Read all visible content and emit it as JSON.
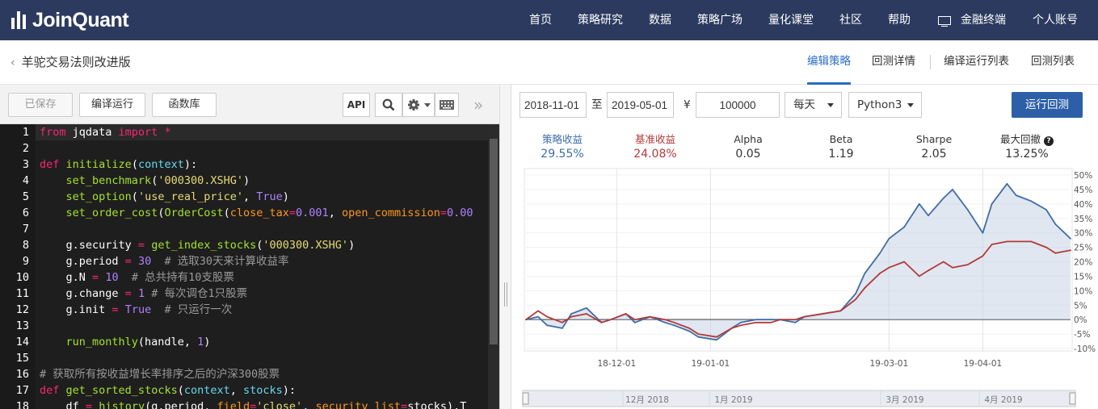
{
  "brand": {
    "name": "JoinQuant"
  },
  "nav": {
    "items": [
      "首页",
      "策略研究",
      "数据",
      "策略广场",
      "量化课堂",
      "社区",
      "帮助"
    ],
    "terminal": "金融终端",
    "account": "个人账号"
  },
  "page": {
    "title": "羊驼交易法则改进版"
  },
  "subtabs": [
    "编辑策略",
    "回测详情",
    "编译运行列表",
    "回测列表"
  ],
  "editor": {
    "saved_label": "已保存",
    "compile_label": "编译运行",
    "library_label": "函数库",
    "api_label": "API",
    "lines": [
      {
        "n": "1",
        "segs": [
          [
            "kw",
            "from"
          ],
          [
            "",
            " jqdata "
          ],
          [
            "kw",
            "import"
          ],
          [
            "",
            " "
          ],
          [
            "kw",
            "*"
          ]
        ]
      },
      {
        "n": "2",
        "segs": []
      },
      {
        "n": "3",
        "segs": [
          [
            "kw",
            "def"
          ],
          [
            "",
            " "
          ],
          [
            "fn",
            "initialize"
          ],
          [
            "",
            "("
          ],
          [
            "bl",
            "context"
          ],
          [
            "",
            "):"
          ]
        ]
      },
      {
        "n": "4",
        "segs": [
          [
            "",
            "    "
          ],
          [
            "fn",
            "set_benchmark"
          ],
          [
            "",
            "("
          ],
          [
            "st",
            "'000300.XSHG'"
          ],
          [
            "",
            ")"
          ]
        ]
      },
      {
        "n": "5",
        "segs": [
          [
            "",
            "    "
          ],
          [
            "fn",
            "set_option"
          ],
          [
            "",
            "("
          ],
          [
            "st",
            "'use_real_price'"
          ],
          [
            "",
            ", "
          ],
          [
            "nm",
            "True"
          ],
          [
            "",
            ")"
          ]
        ]
      },
      {
        "n": "6",
        "segs": [
          [
            "",
            "    "
          ],
          [
            "fn",
            "set_order_cost"
          ],
          [
            "",
            "("
          ],
          [
            "fn",
            "OrderCost"
          ],
          [
            "",
            "("
          ],
          [
            "pm",
            "close_tax"
          ],
          [
            "kw",
            "="
          ],
          [
            "nm",
            "0.001"
          ],
          [
            "",
            ", "
          ],
          [
            "pm",
            "open_commission"
          ],
          [
            "kw",
            "="
          ],
          [
            "nm",
            "0.00"
          ]
        ]
      },
      {
        "n": "7",
        "segs": []
      },
      {
        "n": "8",
        "segs": [
          [
            "",
            "    g.security "
          ],
          [
            "kw",
            "="
          ],
          [
            "",
            " "
          ],
          [
            "fn",
            "get_index_stocks"
          ],
          [
            "",
            "("
          ],
          [
            "st",
            "'000300.XSHG'"
          ],
          [
            "",
            ")"
          ]
        ]
      },
      {
        "n": "9",
        "segs": [
          [
            "",
            "    g.period "
          ],
          [
            "kw",
            "="
          ],
          [
            "",
            " "
          ],
          [
            "nm",
            "30"
          ],
          [
            "",
            "  "
          ],
          [
            "cm",
            "# 选取30天来计算收益率"
          ]
        ]
      },
      {
        "n": "10",
        "segs": [
          [
            "",
            "    g.N "
          ],
          [
            "kw",
            "="
          ],
          [
            "",
            " "
          ],
          [
            "nm",
            "10"
          ],
          [
            "",
            "  "
          ],
          [
            "cm",
            "# 总共持有10支股票"
          ]
        ]
      },
      {
        "n": "11",
        "segs": [
          [
            "",
            "    g.change "
          ],
          [
            "kw",
            "="
          ],
          [
            "",
            " "
          ],
          [
            "nm",
            "1"
          ],
          [
            "",
            " "
          ],
          [
            "cm",
            "# 每次调仓1只股票"
          ]
        ]
      },
      {
        "n": "12",
        "segs": [
          [
            "",
            "    g.init "
          ],
          [
            "kw",
            "="
          ],
          [
            "",
            " "
          ],
          [
            "nm",
            "True"
          ],
          [
            "",
            "  "
          ],
          [
            "cm",
            "# 只运行一次"
          ]
        ]
      },
      {
        "n": "13",
        "segs": []
      },
      {
        "n": "14",
        "segs": [
          [
            "",
            "    "
          ],
          [
            "fn",
            "run_monthly"
          ],
          [
            "",
            "(handle, "
          ],
          [
            "nm",
            "1"
          ],
          [
            "",
            ")"
          ]
        ]
      },
      {
        "n": "15",
        "segs": []
      },
      {
        "n": "16",
        "segs": [
          [
            "cm",
            "# 获取所有按收益增长率排序之后的沪深300股票"
          ]
        ]
      },
      {
        "n": "17",
        "segs": [
          [
            "kw",
            "def"
          ],
          [
            "",
            " "
          ],
          [
            "fn",
            "get_sorted_stocks"
          ],
          [
            "",
            "("
          ],
          [
            "bl",
            "context"
          ],
          [
            "",
            ", "
          ],
          [
            "bl",
            "stocks"
          ],
          [
            "",
            "):"
          ]
        ]
      },
      {
        "n": "18",
        "segs": [
          [
            "",
            "    df "
          ],
          [
            "kw",
            "="
          ],
          [
            "",
            " "
          ],
          [
            "fn",
            "history"
          ],
          [
            "",
            "(g.period, "
          ],
          [
            "pm",
            "field"
          ],
          [
            "kw",
            "="
          ],
          [
            "st",
            "'close'"
          ],
          [
            "",
            ", "
          ],
          [
            "pm",
            "security_list"
          ],
          [
            "kw",
            "="
          ],
          [
            "",
            "stocks).T"
          ]
        ]
      }
    ]
  },
  "backtest": {
    "start": "2018-11-01",
    "to": "至",
    "end": "2019-05-01",
    "currency": "¥",
    "capital": "100000",
    "freq": "每天",
    "lang": "Python3",
    "run_label": "运行回测"
  },
  "metrics": [
    {
      "label": "策略收益",
      "value": "29.55%",
      "color": "#3e6ea6"
    },
    {
      "label": "基准收益",
      "value": "24.08%",
      "color": "#b23a3a"
    },
    {
      "label": "Alpha",
      "value": "0.05",
      "color": "#333333"
    },
    {
      "label": "Beta",
      "value": "1.19",
      "color": "#333333"
    },
    {
      "label": "Sharpe",
      "value": "2.05",
      "color": "#333333"
    },
    {
      "label": "最大回撤",
      "value": "13.25%",
      "color": "#333333"
    }
  ],
  "chart_data": {
    "type": "line",
    "x": [
      "2018-11-01",
      "2018-11-05",
      "2018-11-08",
      "2018-11-13",
      "2018-11-16",
      "2018-11-21",
      "2018-11-26",
      "2018-11-29",
      "2018-12-04",
      "2018-12-07",
      "2018-12-12",
      "2018-12-17",
      "2018-12-20",
      "2018-12-25",
      "2018-12-28",
      "2019-01-03",
      "2019-01-08",
      "2019-01-11",
      "2019-01-16",
      "2019-01-21",
      "2019-01-24",
      "2019-01-29",
      "2019-02-01",
      "2019-02-13",
      "2019-02-18",
      "2019-02-21",
      "2019-02-26",
      "2019-03-01",
      "2019-03-06",
      "2019-03-11",
      "2019-03-14",
      "2019-03-19",
      "2019-03-22",
      "2019-03-27",
      "2019-04-01",
      "2019-04-04",
      "2019-04-09",
      "2019-04-12",
      "2019-04-17",
      "2019-04-22",
      "2019-04-25",
      "2019-04-30"
    ],
    "series": [
      {
        "name": "策略收益",
        "color": "#3e6ea6",
        "values": [
          0,
          1,
          -2,
          -3,
          2,
          4,
          -1,
          0,
          2,
          -1,
          1,
          -1,
          -2,
          -4,
          -6,
          -7,
          -3,
          -1,
          0,
          0,
          0,
          -1,
          1,
          3,
          9,
          16,
          23,
          28,
          32,
          40,
          36,
          42,
          45,
          38,
          30,
          40,
          47,
          43,
          41,
          38,
          33,
          28
        ]
      },
      {
        "name": "基准收益",
        "color": "#b23a3a",
        "values": [
          0,
          3,
          1,
          -1,
          1,
          2,
          -1,
          0,
          2,
          0,
          1,
          0,
          -1,
          -3,
          -5,
          -6,
          -3,
          -2,
          -1,
          -1,
          0,
          0,
          1,
          3,
          7,
          11,
          16,
          18,
          20,
          15,
          17,
          20,
          18,
          19,
          22,
          26,
          27,
          27,
          27,
          25,
          23,
          24
        ]
      }
    ],
    "ylim": [
      -10,
      50
    ],
    "yticks": [
      "50%",
      "45%",
      "40%",
      "35%",
      "30%",
      "25%",
      "20%",
      "15%",
      "10%",
      "5%",
      "0%",
      "-5%",
      "-10%"
    ],
    "xticks": [
      "18-12-01",
      "19-01-01",
      "19-03-01",
      "19-04-01"
    ],
    "navigator": [
      "12月 2018",
      "1月 2019",
      "3月 2019",
      "4月 2019"
    ]
  }
}
